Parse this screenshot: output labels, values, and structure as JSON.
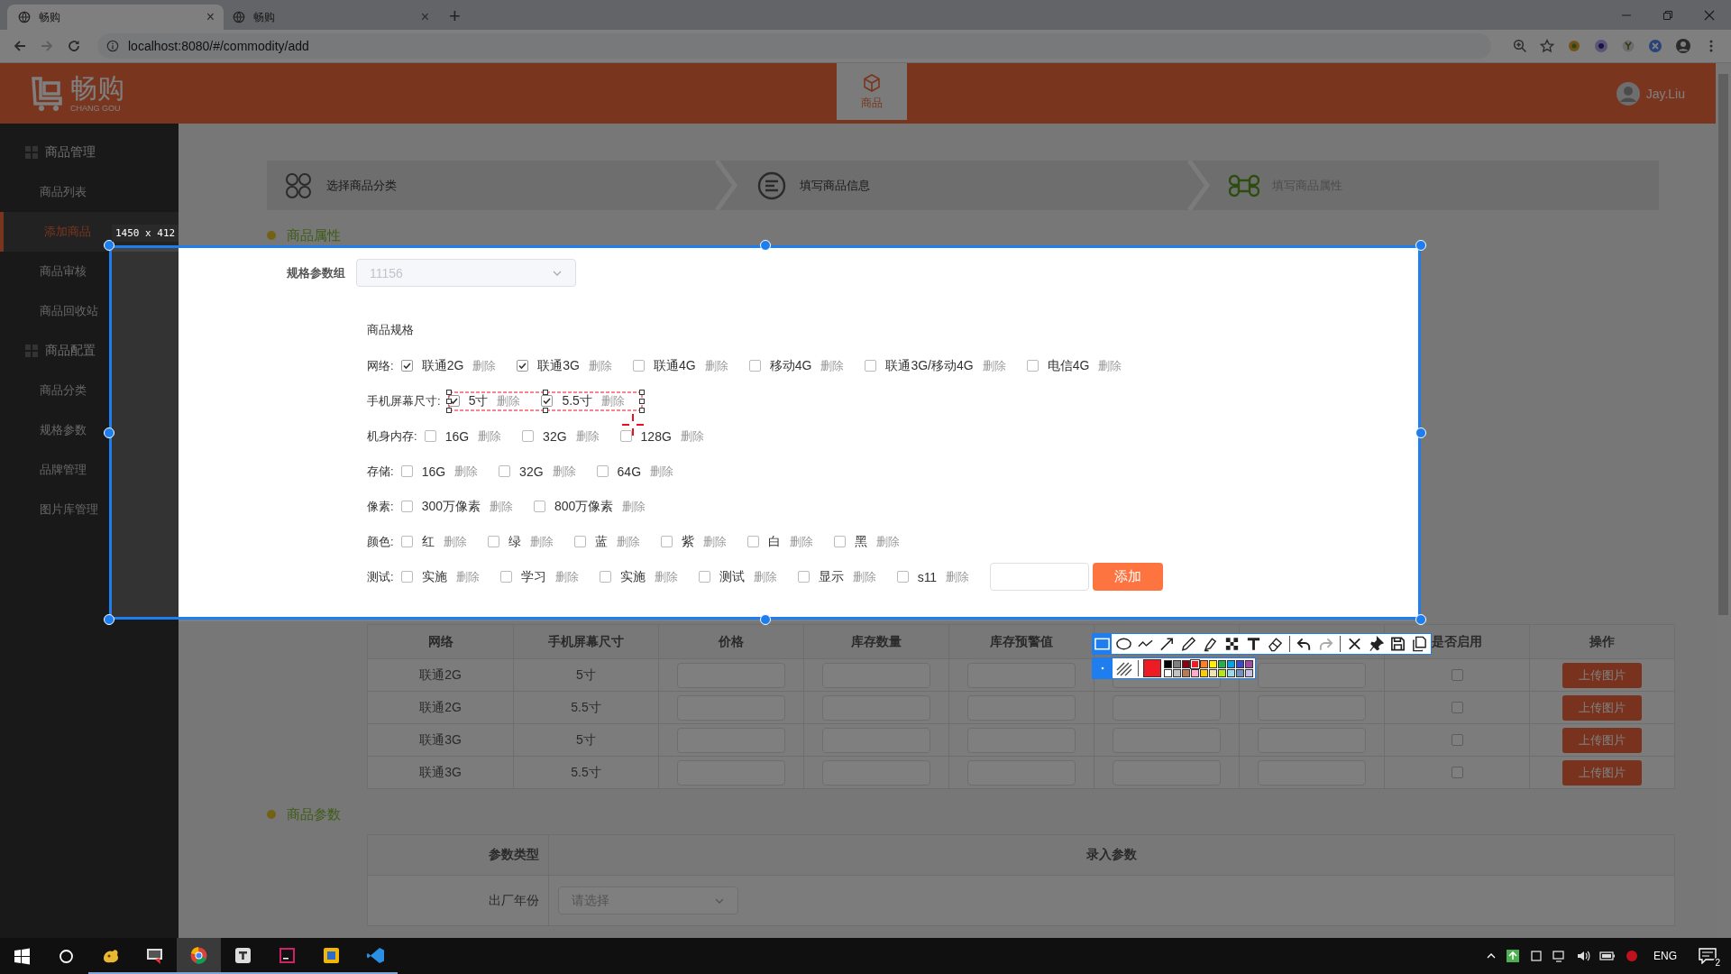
{
  "browser": {
    "tabs": [
      {
        "title": "畅购",
        "selected": true,
        "close": "×"
      },
      {
        "title": "畅购",
        "selected": false,
        "close": "×"
      }
    ],
    "new_tab": "+",
    "url": "localhost:8080/#/commodity/add"
  },
  "header": {
    "logo": "畅购",
    "logo_subtitle": "CHANG GOU",
    "nav": [
      {
        "label": "商品",
        "selected": true
      }
    ],
    "user": "Jay.Liu"
  },
  "sidebar": [
    {
      "title": "商品管理",
      "items": [
        {
          "label": "商品列表",
          "selected": false
        },
        {
          "label": "添加商品",
          "selected": true
        },
        {
          "label": "商品审核",
          "selected": false
        },
        {
          "label": "商品回收站",
          "selected": false
        }
      ]
    },
    {
      "title": "商品配置",
      "items": [
        {
          "label": "商品分类",
          "selected": false
        },
        {
          "label": "规格参数",
          "selected": false
        },
        {
          "label": "品牌管理",
          "selected": false
        },
        {
          "label": "图片库管理",
          "selected": false
        }
      ]
    }
  ],
  "steps": [
    {
      "label": "选择商品分类",
      "kind": "clover",
      "reached": true
    },
    {
      "label": "填写商品信息",
      "kind": "lines",
      "reached": true
    },
    {
      "label": "填写商品属性",
      "kind": "command",
      "reached": false
    }
  ],
  "attributes": {
    "heading": "商品属性",
    "spec_group": {
      "label": "规格参数组",
      "value": "11156",
      "disabled": true
    },
    "spec_title": "商品规格",
    "specs": [
      {
        "label": "网络:",
        "options": [
          {
            "label": "联通2G",
            "checked": true,
            "delete": "删除"
          },
          {
            "label": "联通3G",
            "checked": true,
            "delete": "删除"
          },
          {
            "label": "联通4G",
            "checked": false,
            "delete": "删除"
          },
          {
            "label": "移动4G",
            "checked": false,
            "delete": "删除"
          },
          {
            "label": "联通3G/移动4G",
            "checked": false,
            "delete": "删除"
          },
          {
            "label": "电信4G",
            "checked": false,
            "delete": "删除"
          }
        ]
      },
      {
        "label": "手机屏幕尺寸:",
        "options": [
          {
            "label": "5寸",
            "checked": true,
            "delete": "删除"
          },
          {
            "label": "5.5寸",
            "checked": true,
            "delete": "删除"
          }
        ]
      },
      {
        "label": "机身内存:",
        "options": [
          {
            "label": "16G",
            "checked": false,
            "delete": "删除"
          },
          {
            "label": "32G",
            "checked": false,
            "delete": "删除"
          },
          {
            "label": "128G",
            "checked": false,
            "delete": "删除"
          }
        ]
      },
      {
        "label": "存储:",
        "options": [
          {
            "label": "16G",
            "checked": false,
            "delete": "删除"
          },
          {
            "label": "32G",
            "checked": false,
            "delete": "删除"
          },
          {
            "label": "64G",
            "checked": false,
            "delete": "删除"
          }
        ]
      },
      {
        "label": "像素:",
        "options": [
          {
            "label": "300万像素",
            "checked": false,
            "delete": "删除"
          },
          {
            "label": "800万像素",
            "checked": false,
            "delete": "删除"
          }
        ]
      },
      {
        "label": "颜色:",
        "options": [
          {
            "label": "红",
            "checked": false,
            "delete": "删除"
          },
          {
            "label": "绿",
            "checked": false,
            "delete": "删除"
          },
          {
            "label": "蓝",
            "checked": false,
            "delete": "删除"
          },
          {
            "label": "紫",
            "checked": false,
            "delete": "删除"
          },
          {
            "label": "白",
            "checked": false,
            "delete": "删除"
          },
          {
            "label": "黑",
            "checked": false,
            "delete": "删除"
          }
        ]
      },
      {
        "label": "测试:",
        "options": [
          {
            "label": "实施",
            "checked": false,
            "delete": "删除"
          },
          {
            "label": "学习",
            "checked": false,
            "delete": "删除"
          },
          {
            "label": "实施",
            "checked": false,
            "delete": "删除"
          },
          {
            "label": "测试",
            "checked": false,
            "delete": "删除"
          },
          {
            "label": "显示",
            "checked": false,
            "delete": "删除"
          },
          {
            "label": "s11",
            "checked": false,
            "delete": "删除"
          }
        ]
      }
    ],
    "add_button": "添加"
  },
  "sku_table": {
    "columns": [
      {
        "label": "网络",
        "kind": "text"
      },
      {
        "label": "手机屏幕尺寸",
        "kind": "text"
      },
      {
        "label": "价格",
        "kind": "input"
      },
      {
        "label": "库存数量",
        "kind": "input"
      },
      {
        "label": "库存预警值",
        "kind": "input"
      },
      {
        "kind": "input"
      },
      {
        "kind": "input"
      },
      {
        "label": "是否启用",
        "kind": "checkbox"
      },
      {
        "label": "操作",
        "kind": "button"
      }
    ],
    "rows": [
      {
        "cells": [
          "联通2G",
          "5寸"
        ],
        "enabled": false,
        "button": "上传图片"
      },
      {
        "cells": [
          "联通2G",
          "5.5寸"
        ],
        "enabled": false,
        "button": "上传图片"
      },
      {
        "cells": [
          "联通3G",
          "5寸"
        ],
        "enabled": false,
        "button": "上传图片"
      },
      {
        "cells": [
          "联通3G",
          "5.5寸"
        ],
        "enabled": false,
        "button": "上传图片"
      }
    ]
  },
  "params": {
    "heading": "商品参数",
    "columns": [
      "参数类型",
      "录入参数"
    ],
    "rows": [
      {
        "label": "出厂年份",
        "placeholder": "请选择"
      }
    ]
  },
  "capture": {
    "size": "1450 x 412",
    "tools": [
      {
        "kind": "rect",
        "selected": true,
        "disabled": false
      },
      {
        "kind": "ellipse",
        "selected": false,
        "disabled": false
      },
      {
        "kind": "polyline",
        "selected": false,
        "disabled": false
      },
      {
        "kind": "arrow",
        "selected": false,
        "disabled": false
      },
      {
        "kind": "pen",
        "selected": false,
        "disabled": false
      },
      {
        "kind": "marker",
        "selected": false,
        "disabled": false
      },
      {
        "kind": "mosaic",
        "selected": false,
        "disabled": false
      },
      {
        "kind": "text",
        "selected": false,
        "disabled": false
      },
      {
        "kind": "eraser",
        "selected": false,
        "disabled": false
      },
      {
        "kind": "undo",
        "selected": false,
        "disabled": false
      },
      {
        "kind": "redo",
        "selected": false,
        "disabled": true
      },
      {
        "kind": "cancel",
        "selected": false,
        "disabled": false
      },
      {
        "kind": "pin",
        "selected": false,
        "disabled": false
      },
      {
        "kind": "save",
        "selected": false,
        "disabled": false
      },
      {
        "kind": "copy",
        "selected": false,
        "disabled": false
      }
    ],
    "palette": [
      {
        "color": "#000000",
        "selected": false
      },
      {
        "color": "#7f7f7f",
        "selected": false
      },
      {
        "color": "#880015",
        "selected": false
      },
      {
        "color": "#ed1c24",
        "selected": true
      },
      {
        "color": "#ff7f27",
        "selected": false
      },
      {
        "color": "#fff200",
        "selected": false
      },
      {
        "color": "#22b14c",
        "selected": false
      },
      {
        "color": "#00a2e8",
        "selected": false
      },
      {
        "color": "#3f48cc",
        "selected": false
      },
      {
        "color": "#a349a4",
        "selected": false
      },
      {
        "color": "#ffffff",
        "selected": false
      },
      {
        "color": "#c3c3c3",
        "selected": false
      },
      {
        "color": "#b97a57",
        "selected": false
      },
      {
        "color": "#ffaec9",
        "selected": false
      },
      {
        "color": "#ffc90e",
        "selected": false
      },
      {
        "color": "#efe4b0",
        "selected": false
      },
      {
        "color": "#b5e61d",
        "selected": false
      },
      {
        "color": "#99d9ea",
        "selected": false
      },
      {
        "color": "#7092be",
        "selected": false
      },
      {
        "color": "#c8bfe7",
        "selected": false
      }
    ]
  },
  "taskbar": {
    "apps": [
      {
        "kind": "windows",
        "selected": false,
        "running": false
      },
      {
        "kind": "search",
        "selected": false,
        "running": false
      },
      {
        "kind": "blob",
        "selected": false,
        "running": true
      },
      {
        "kind": "monitor",
        "selected": false,
        "running": true
      },
      {
        "kind": "browser",
        "selected": true,
        "running": true
      },
      {
        "kind": "note",
        "selected": false,
        "running": true
      },
      {
        "kind": "ide",
        "selected": false,
        "running": true
      },
      {
        "kind": "cube",
        "selected": false,
        "running": true
      },
      {
        "kind": "ribbon",
        "selected": false,
        "running": true
      }
    ],
    "language": "ENG",
    "notifications": "2"
  }
}
